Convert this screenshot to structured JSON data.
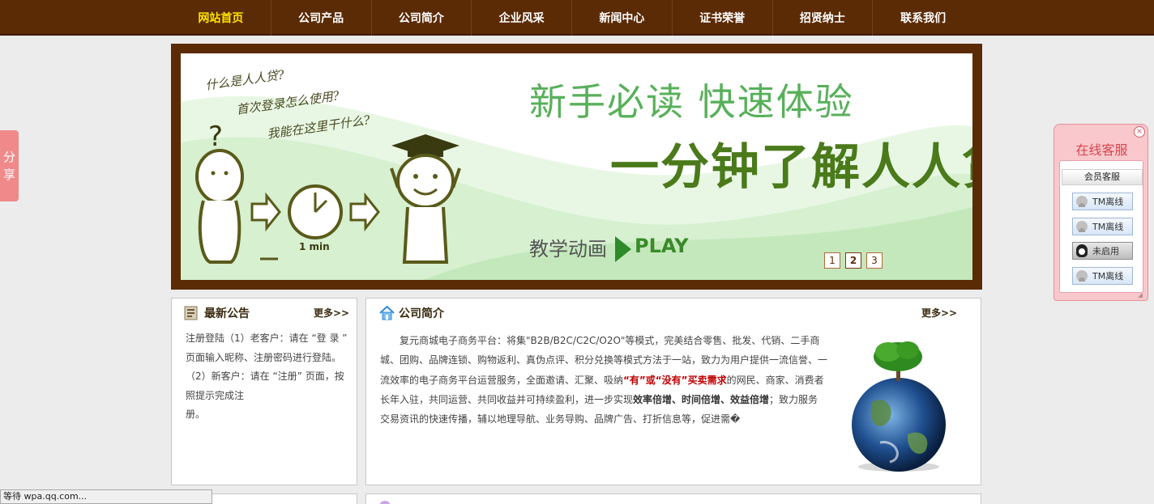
{
  "nav": {
    "items": [
      {
        "label": "网站首页",
        "active": true
      },
      {
        "label": "公司产品"
      },
      {
        "label": "公司简介"
      },
      {
        "label": "企业风采"
      },
      {
        "label": "新闻中心"
      },
      {
        "label": "证书荣誉"
      },
      {
        "label": "招贤纳士"
      },
      {
        "label": "联系我们"
      }
    ]
  },
  "banner": {
    "question1": "什么是人人贷?",
    "question2": "首次登录怎么使用?",
    "question3": "我能在这里干什么?",
    "minute_label": "1 min",
    "headline1": "新手必读 快速体验",
    "headline2": "一分钟了解人人贷",
    "play_label": "教学动画",
    "play_word": "PLAY",
    "pages": [
      "1",
      "2",
      "3"
    ]
  },
  "notice": {
    "title": "最新公告",
    "more": "更多>>",
    "body": "注册登陆（1）老客户：请在 “登 录 ” 页面输入昵称、注册密码进行登陆。（2）新客户：请在 “注册” 页面，按照提示完成注",
    "body_end": "册。"
  },
  "intro": {
    "title": "公司简介",
    "more": "更多>>",
    "p1": "　　复元商城电子商务平台：将集\"B2B/B2C/C2C/O2O\"等模式，完美结合零售、批发、代销、二手商城、团购、品牌连锁、购物返利、真伪点评、积分兑换等模式方法于一站，致力为用户提供一流信誉、一流效率的电子商务平台运营服务，全面邀请、汇聚、吸纳",
    "red": "“有”或“没有”买卖需求",
    "p2": "的网民、商家、消费者长年入驻，共同运营、共同收益并可持续盈利，进一步实现",
    "bold": "效率倍增、时间倍增、效益倍增",
    "p3": "；致力服务交易资讯的快速传播，辅以地理导航、业务导购、品牌广告、打折信息等，促进需�"
  },
  "share": {
    "label1": "分",
    "label2": "享"
  },
  "cs": {
    "title": "在线客服",
    "close": "×",
    "group": "会员客服",
    "buttons": [
      {
        "label": "TM离线"
      },
      {
        "label": "TM离线"
      },
      {
        "label": "未启用"
      },
      {
        "label": "TM离线"
      }
    ]
  },
  "status": {
    "text": "等待 wpa.qq.com..."
  },
  "colors": {
    "nav_bg": "#5b2b06",
    "nav_active": "#ffe400",
    "accent_red": "#c00000",
    "cs_title": "#d8464e"
  }
}
